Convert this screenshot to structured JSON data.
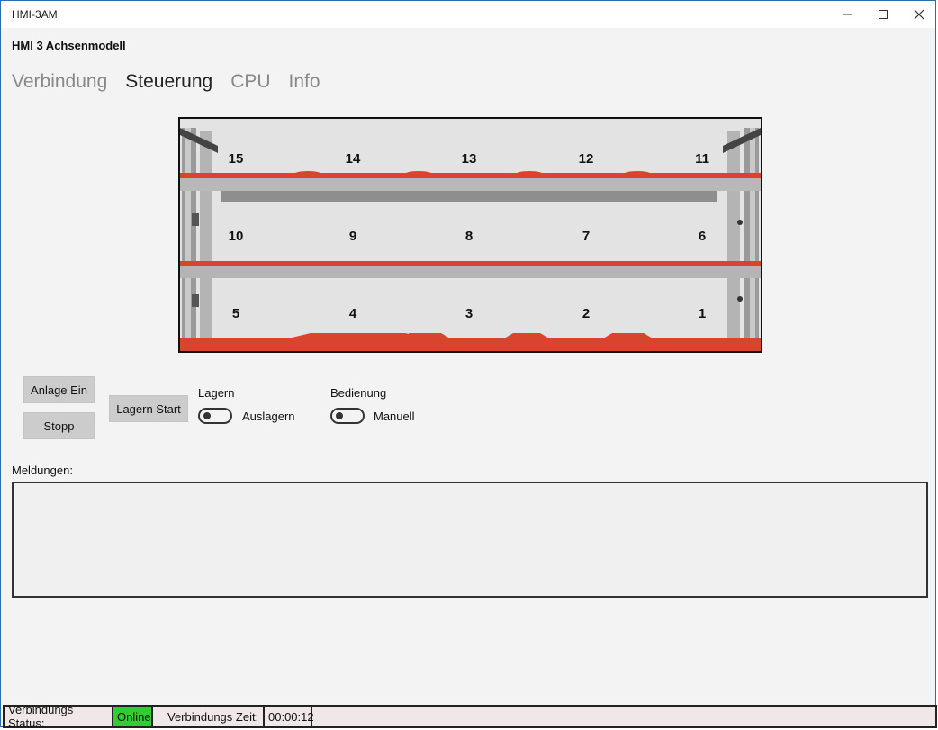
{
  "window": {
    "title": "HMI-3AM"
  },
  "header": {
    "app_title": "HMI 3 Achsenmodell"
  },
  "tabs": [
    {
      "label": "Verbindung"
    },
    {
      "label": "Steuerung"
    },
    {
      "label": "CPU"
    },
    {
      "label": "Info"
    }
  ],
  "shelf": {
    "rows": [
      [
        "15",
        "14",
        "13",
        "12",
        "11"
      ],
      [
        "10",
        "9",
        "8",
        "7",
        "6"
      ],
      [
        "5",
        "4",
        "3",
        "2",
        "1"
      ]
    ]
  },
  "controls": {
    "anlage_ein": "Anlage Ein",
    "stopp": "Stopp",
    "lagern_start": "Lagern Start",
    "lagern_label": "Lagern",
    "lagern_toggle_text": "Auslagern",
    "bedienung_label": "Bedienung",
    "bedienung_toggle_text": "Manuell"
  },
  "messages": {
    "label": "Meldungen:"
  },
  "status": {
    "status_label": "Verbindungs Status:",
    "status_value": "Online",
    "time_label": "Verbindungs Zeit:",
    "time_value": "00:00:12"
  },
  "colors": {
    "online": "#33cc33",
    "shelf_red": "#d8452c"
  }
}
